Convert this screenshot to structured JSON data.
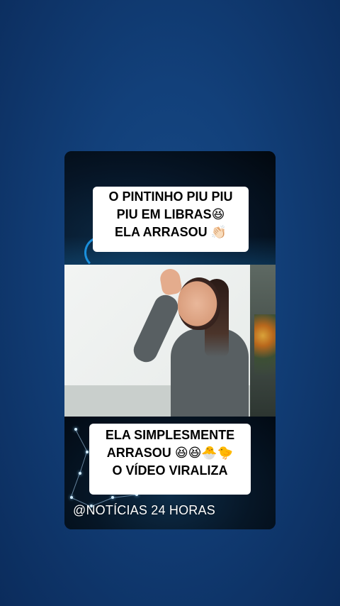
{
  "post": {
    "caption_top": {
      "line1": "O PINTINHO PIU PIU",
      "line2": "PIU EM LIBRAS",
      "line2_emoji": "😆",
      "line3": "ELA ARRASOU",
      "line3_emoji": "👏🏻"
    },
    "caption_bottom": {
      "line1": "ELA SIMPLESMENTE",
      "line2": "ARRASOU",
      "line2_emoji": "😆😆🐣🐤",
      "line3": "O VÍDEO VIRALIZA"
    },
    "handle": "@NOTÍCIAS 24 HORAS"
  },
  "colors": {
    "background": "#12407a",
    "caption_bg": "#ffffff",
    "caption_text": "#000000",
    "handle_text": "#ffffff"
  }
}
